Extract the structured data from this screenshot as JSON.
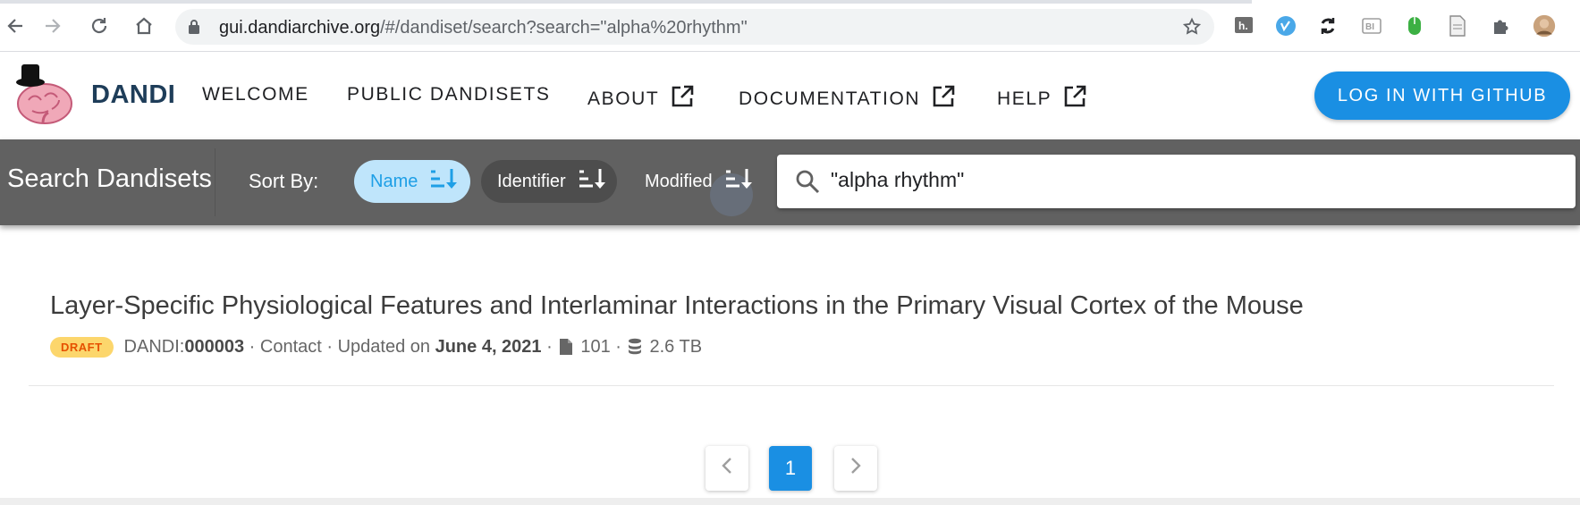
{
  "browser": {
    "url_host": "gui.dandiarchive.org",
    "url_rest": "/#/dandiset/search?search=\"alpha%20rhythm\"",
    "icons": [
      "back-icon",
      "forward-icon",
      "reload-icon",
      "home-icon",
      "lock-icon",
      "bookmark-star-icon",
      "extension-icons",
      "puzzle-icon",
      "profile-avatar"
    ]
  },
  "header": {
    "brand": "DANDI",
    "nav": {
      "welcome": "WELCOME",
      "public_dandisets": "PUBLIC DANDISETS",
      "about": "ABOUT",
      "documentation": "DOCUMENTATION",
      "help": "HELP"
    },
    "login_label": "LOG IN WITH GITHUB"
  },
  "search": {
    "title": "Search Dandisets",
    "sort_by_label": "Sort By:",
    "sort_options": {
      "name": "Name",
      "identifier": "Identifier",
      "modified": "Modified"
    },
    "query": "\"alpha rhythm\""
  },
  "results": [
    {
      "title": "Layer-Specific Physiological Features and Interlaminar Interactions in the Primary Visual Cortex of the Mouse",
      "status": "DRAFT",
      "id_prefix": "DANDI:",
      "id": "000003",
      "contact": "Contact",
      "updated_prefix": "Updated on",
      "updated_date": "June 4, 2021",
      "files": "101",
      "size": "2.6 TB"
    }
  ],
  "pagination": {
    "current_page": "1"
  },
  "colors": {
    "accent": "#1a8fe3",
    "toolbar": "#616161",
    "brand": "#1e3d59",
    "draft_badge": "#fcd66c"
  }
}
